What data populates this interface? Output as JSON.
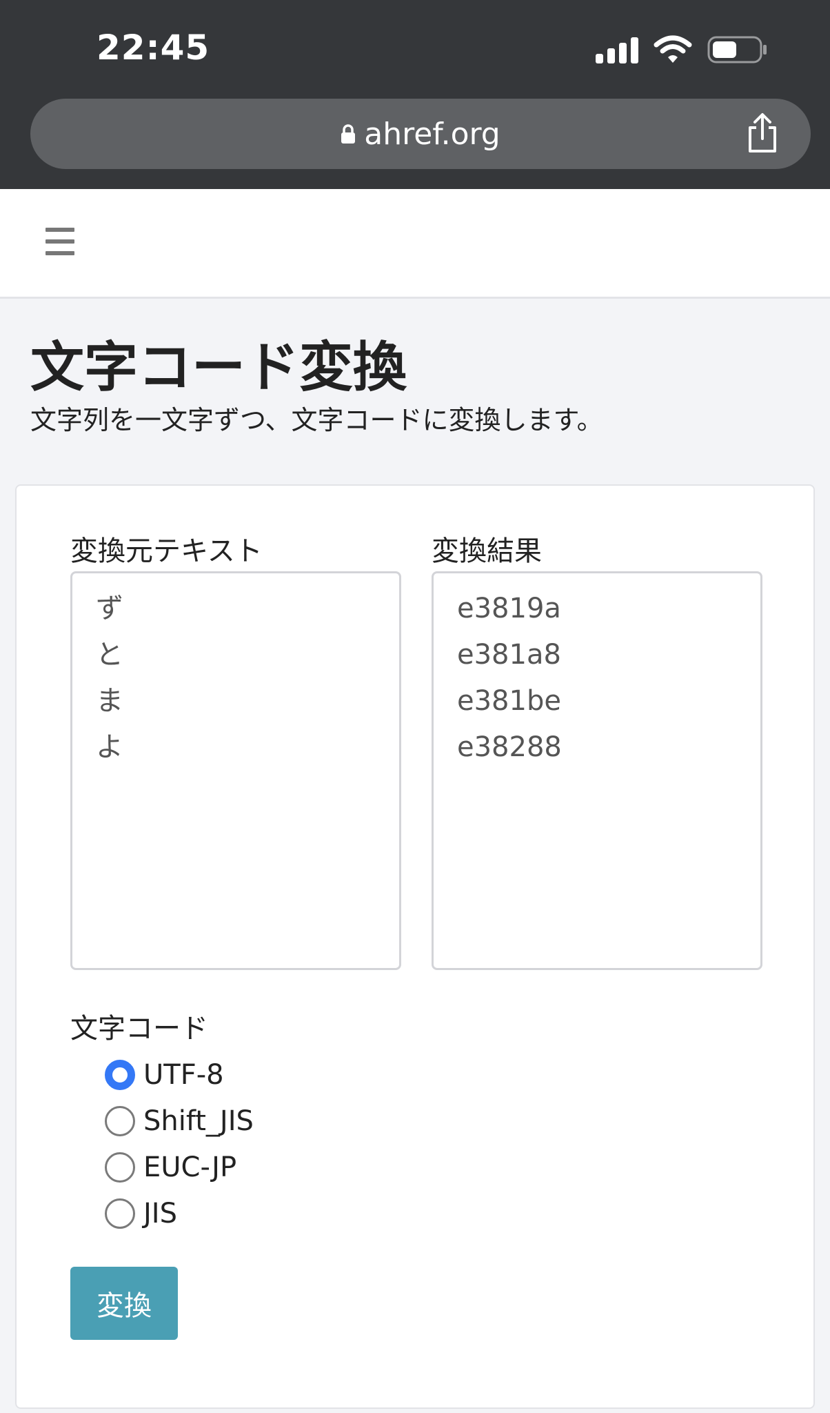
{
  "status_bar": {
    "time": "22:45"
  },
  "browser": {
    "url": "ahref.org"
  },
  "page": {
    "title": "文字コード変換",
    "subtitle": "文字列を一文字ずつ、文字コードに変換します。"
  },
  "form": {
    "source_label": "変換元テキスト",
    "source_lines": [
      "ず",
      "と",
      "ま",
      "よ"
    ],
    "result_label": "変換結果",
    "result_lines": [
      "e3819a",
      "e381a8",
      "e381be",
      "e38288"
    ],
    "encoding_label": "文字コード",
    "encodings": [
      {
        "label": "UTF-8",
        "checked": true
      },
      {
        "label": "Shift_JIS",
        "checked": false
      },
      {
        "label": "EUC-JP",
        "checked": false
      },
      {
        "label": "JIS",
        "checked": false
      }
    ],
    "convert_label": "変換"
  },
  "colors": {
    "chrome": "#35373a",
    "urlbar": "#5f6164",
    "accent_radio": "#3478f6",
    "button": "#4a9fb4"
  }
}
